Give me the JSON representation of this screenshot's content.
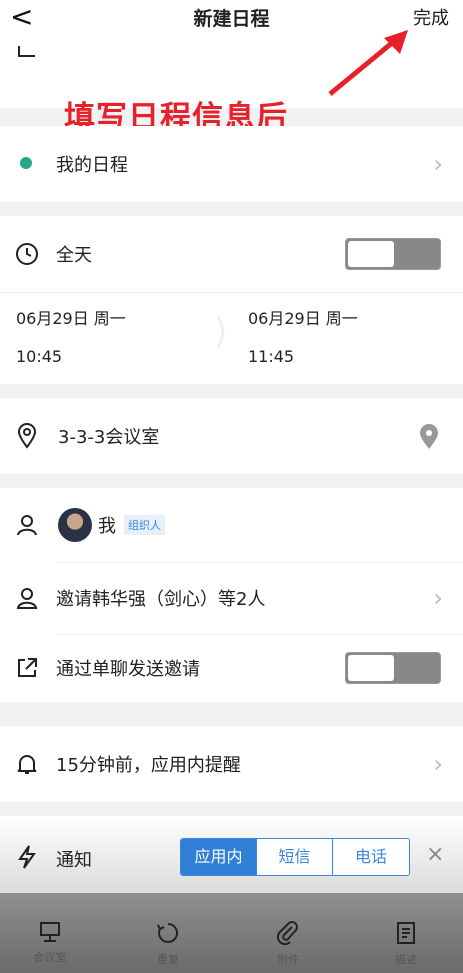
{
  "header": {
    "title": "新建日程",
    "done_label": "完成",
    "back_glyph": "<"
  },
  "annotation": {
    "text": "填写日程信息后"
  },
  "calendar": {
    "name": "我的日程",
    "dot_color": "#2aa58a"
  },
  "all_day": {
    "label": "全天",
    "enabled": false
  },
  "time": {
    "start_date": "06月29日 周一",
    "start_time": "10:45",
    "end_date": "06月29日 周一",
    "end_time": "11:45"
  },
  "location": {
    "value": "3-3-3会议室"
  },
  "organizer": {
    "name": "我",
    "role": "组织人"
  },
  "invitees": {
    "label": "邀请韩华强（剑心）等2人"
  },
  "private_invite": {
    "label": "通过单聊发送邀请",
    "enabled": false
  },
  "reminder": {
    "label": "15分钟前，应用内提醒"
  },
  "notify": {
    "label": "通知",
    "options": [
      "应用内",
      "短信",
      "电话"
    ],
    "selected": "应用内"
  },
  "tabbar": {
    "items": [
      {
        "label": "会议室",
        "icon": "meeting-room-icon"
      },
      {
        "label": "重复",
        "icon": "repeat-icon"
      },
      {
        "label": "附件",
        "icon": "attachment-icon"
      },
      {
        "label": "描述",
        "icon": "description-icon"
      }
    ]
  },
  "colors": {
    "accent": "#2f7fd6",
    "annotation": "#e8202a"
  }
}
